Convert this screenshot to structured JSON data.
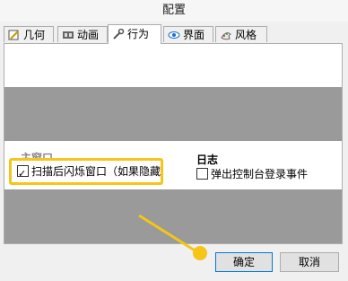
{
  "window": {
    "title": "配置"
  },
  "tabs": [
    {
      "label": "几何",
      "icon": "pencil-icon"
    },
    {
      "label": "动画",
      "icon": "film-icon"
    },
    {
      "label": "行为",
      "icon": "wrench-icon",
      "active": true
    },
    {
      "label": "界面",
      "icon": "eye-icon"
    },
    {
      "label": "风格",
      "icon": "palette-icon"
    }
  ],
  "sections": {
    "left_heading": "主窗口",
    "flash_option": {
      "label": "扫描后闪烁窗口（如果隐藏",
      "checked": true
    },
    "log_heading": "日志",
    "login_option": {
      "label": "弹出控制台登录事件",
      "checked": false
    }
  },
  "buttons": {
    "ok": "确定",
    "cancel": "取消"
  },
  "colors": {
    "highlight": "#f5c518",
    "focus_border": "#0078d7"
  }
}
